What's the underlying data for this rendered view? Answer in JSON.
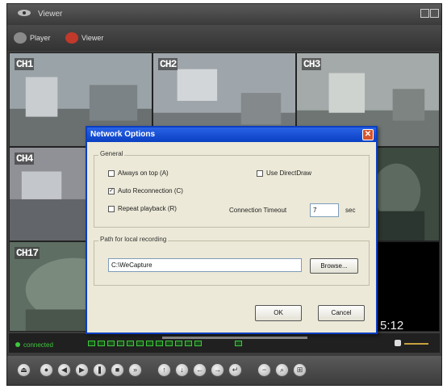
{
  "window": {
    "title": "Viewer"
  },
  "modes": [
    {
      "label": "Player",
      "icon": "player-icon",
      "color": "#8a8a8a"
    },
    {
      "label": "Viewer",
      "icon": "viewer-icon",
      "color": "#c0392b"
    }
  ],
  "channels": [
    {
      "label": "CH1",
      "scene": "#9aa3a8"
    },
    {
      "label": "CH2",
      "scene": "#9ea6ab"
    },
    {
      "label": "CH3",
      "scene": "#a3aaa9"
    },
    {
      "label": "CH4",
      "scene": "#8f9196"
    },
    {
      "label": "CH17",
      "scene": "#5e6e62"
    }
  ],
  "time_display": "5:12",
  "status": {
    "text": "connected"
  },
  "dialog": {
    "title": "Network Options",
    "general": {
      "label": "General",
      "always_on_top": {
        "label": "Always on top (A)",
        "checked": false
      },
      "auto_reconnection": {
        "label": "Auto Reconnection (C)",
        "checked": true
      },
      "repeat_playback": {
        "label": "Repeat playback (R)",
        "checked": false
      },
      "use_directdraw": {
        "label": "Use DirectDraw",
        "checked": false
      },
      "connection_timeout": {
        "label": "Connection Timeout",
        "value": "7",
        "unit": "sec"
      }
    },
    "recording": {
      "label": "Path for local recording",
      "path": "C:\\WeCapture",
      "browse_label": "Browse..."
    },
    "ok_label": "OK",
    "cancel_label": "Cancel"
  },
  "colors": {
    "accent": "#0a3fc2",
    "status_green": "#3ec83e",
    "dialog_bg": "#ece9d8"
  }
}
